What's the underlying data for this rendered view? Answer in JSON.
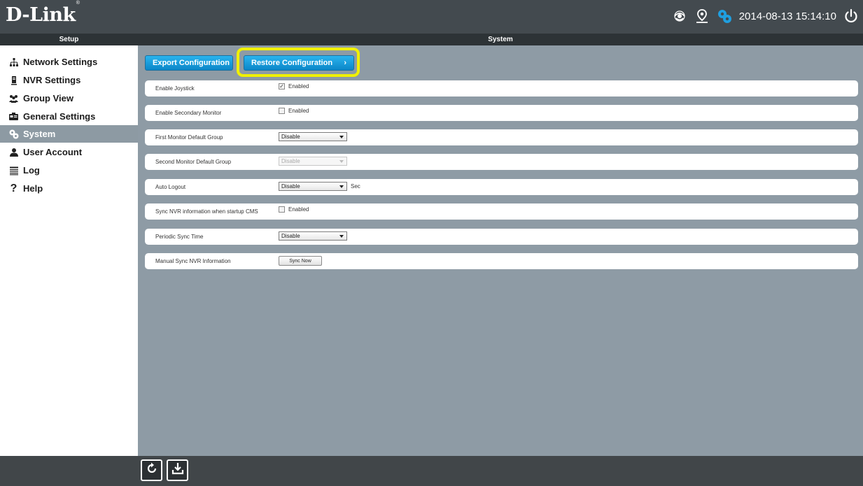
{
  "brand": {
    "name": "D-Link",
    "mark": "®"
  },
  "topbar": {
    "datetime": "2014-08-13 15:14:10"
  },
  "header": {
    "left": "Setup",
    "right": "System"
  },
  "sidebar": {
    "items": [
      {
        "label": "Network Settings",
        "icon": "network-icon"
      },
      {
        "label": "NVR Settings",
        "icon": "nvr-icon"
      },
      {
        "label": "Group View",
        "icon": "group-icon"
      },
      {
        "label": "General Settings",
        "icon": "general-settings-icon"
      },
      {
        "label": "System",
        "icon": "system-gear-icon",
        "active": true
      },
      {
        "label": "User Account",
        "icon": "user-icon"
      },
      {
        "label": "Log",
        "icon": "log-icon"
      },
      {
        "label": "Help",
        "icon": "help-icon"
      }
    ]
  },
  "actions": {
    "export": "Export Configuration",
    "restore": "Restore Configuration",
    "restore_arrow": "›"
  },
  "settings": {
    "joystick": {
      "label": "Enable Joystick",
      "option": "Enabled",
      "checked": true,
      "mark": "✓"
    },
    "secondary": {
      "label": "Enable Secondary Monitor",
      "option": "Enabled",
      "checked": false
    },
    "first_group": {
      "label": "First Monitor Default Group",
      "value": "Disable"
    },
    "second_group": {
      "label": "Second Monitor Default Group",
      "value": "Disable",
      "disabled": true
    },
    "auto_logout": {
      "label": "Auto Logout",
      "value": "Disable",
      "unit": "Sec"
    },
    "sync_startup": {
      "label": "Sync NVR information when startup CMS",
      "option": "Enabled",
      "checked": false
    },
    "periodic": {
      "label": "Periodic Sync Time",
      "value": "Disable"
    },
    "manual_sync": {
      "label": "Manual Sync NVR Information",
      "button": "Sync Now"
    }
  },
  "colors": {
    "accent": "#0b86c8",
    "highlight": "#f0f000",
    "main_bg": "#8e9ba5",
    "topbar": "#434a4f"
  }
}
